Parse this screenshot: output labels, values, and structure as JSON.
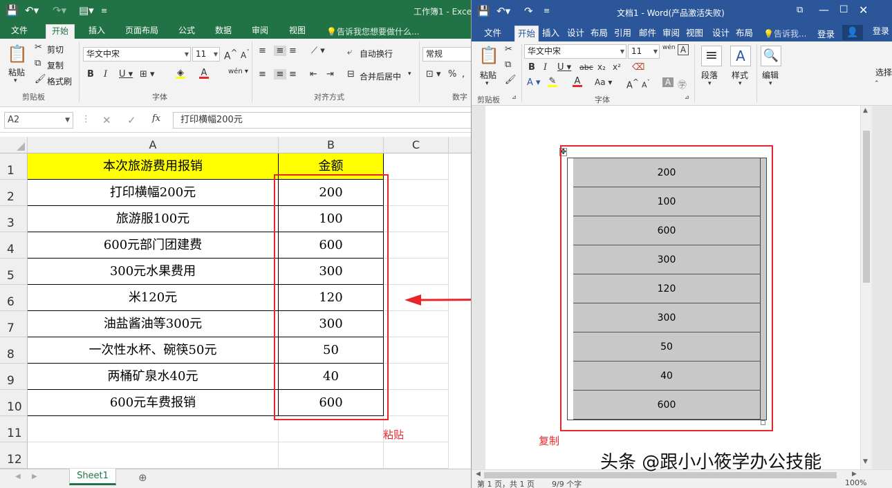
{
  "excel": {
    "title": "工作簿1 - Exce",
    "tabs": [
      "文件",
      "开始",
      "插入",
      "页面布局",
      "公式",
      "数据",
      "审阅",
      "视图"
    ],
    "tell_me": "告诉我您想要做什么...",
    "clipboard": {
      "paste": "粘贴",
      "cut": "剪切",
      "copy": "复制",
      "format_painter": "格式刷",
      "group": "剪贴板"
    },
    "font": {
      "name": "华文中宋",
      "size": "11",
      "group": "字体"
    },
    "alignment": {
      "wrap": "自动换行",
      "merge": "合并后居中",
      "group": "对齐方式"
    },
    "number": {
      "format": "常规",
      "group": "数字"
    },
    "name_box": "A2",
    "formula": "打印横幅200元",
    "columns": [
      "A",
      "B",
      "C"
    ],
    "rows": [
      "1",
      "2",
      "3",
      "4",
      "5",
      "6",
      "7",
      "8",
      "9",
      "10",
      "11",
      "12"
    ],
    "header": {
      "a": "本次旅游费用报销",
      "b": "金额"
    },
    "data": [
      {
        "a": "打印横幅200元",
        "b": "200"
      },
      {
        "a": "旅游服100元",
        "b": "100"
      },
      {
        "a": "600元部门团建费",
        "b": "600"
      },
      {
        "a": "300元水果费用",
        "b": "300"
      },
      {
        "a": "米120元",
        "b": "120"
      },
      {
        "a": "油盐酱油等300元",
        "b": "300"
      },
      {
        "a": "一次性水杯、碗筷50元",
        "b": "50"
      },
      {
        "a": "两桶矿泉水40元",
        "b": "40"
      },
      {
        "a": "600元车费报销",
        "b": "600"
      }
    ],
    "sheet": "Sheet1",
    "paste_label": "粘贴"
  },
  "word": {
    "title": "文档1 - Word(产品激活失败)",
    "tabs": [
      "文件",
      "开始",
      "插入",
      "设计",
      "布局",
      "引用",
      "邮件",
      "审阅",
      "视图",
      "设计",
      "布局"
    ],
    "tell_me": "告诉我...",
    "login": "登录",
    "login2": "登录",
    "select": "选择",
    "clipboard": {
      "paste": "粘贴",
      "group": "剪贴板"
    },
    "font": {
      "name": "华文中宋",
      "size": "11",
      "group": "字体",
      "pinyin": "wén"
    },
    "paragraph": "段落",
    "styles": "样式",
    "editing": "编辑",
    "values": [
      "200",
      "100",
      "600",
      "300",
      "120",
      "300",
      "50",
      "40",
      "600"
    ],
    "copy_label": "复制",
    "status": {
      "page": "第 1 页，共 1 页",
      "words": "9/9 个字",
      "zoom": "100%"
    }
  },
  "watermark": "头条 @跟小小筱学办公技能",
  "colors": {
    "excel_green": "#217346",
    "word_blue": "#2b579a",
    "highlight": "#ffff00",
    "annotation_red": "#e8262a"
  }
}
